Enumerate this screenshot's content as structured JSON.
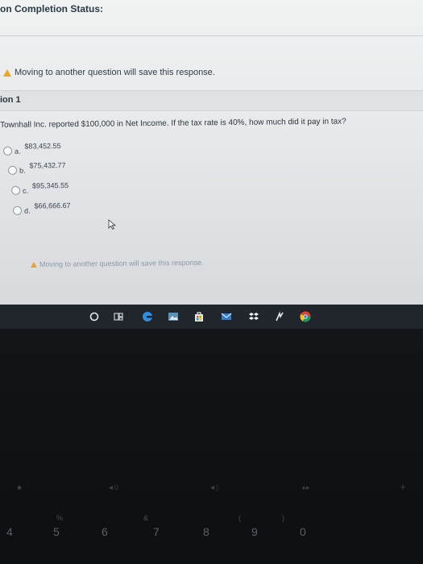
{
  "page": {
    "status_title": "on Completion Status:",
    "warning_top": "Moving to another question will save this response.",
    "question_number": "ion 1",
    "question_text": "Townhall Inc. reported $100,000 in Net Income. If the tax rate is 40%, how much did it pay in tax?",
    "options": [
      {
        "letter": "a.",
        "value": "$83,452.55"
      },
      {
        "letter": "b.",
        "value": "$75,432.77"
      },
      {
        "letter": "c.",
        "value": "$95,345.55"
      },
      {
        "letter": "d.",
        "value": "$66,666.67"
      }
    ],
    "warning_bottom": "Moving to another question will save this response."
  },
  "taskbar": {
    "icons": [
      "search-circle-icon",
      "task-view-icon",
      "edge-icon",
      "photos-icon",
      "store-icon",
      "mail-icon",
      "dropbox-icon",
      "scribble-icon",
      "chrome-icon"
    ]
  },
  "keyboard": {
    "number_keys": [
      "4",
      "5",
      "6",
      "7",
      "8",
      "9",
      "0"
    ],
    "symbol_keys": [
      "%",
      "&",
      "(",
      ")"
    ]
  },
  "colors": {
    "warning": "#e8a623",
    "page_bg": "#e6e8ea",
    "taskbar_bg": "#20262c"
  }
}
